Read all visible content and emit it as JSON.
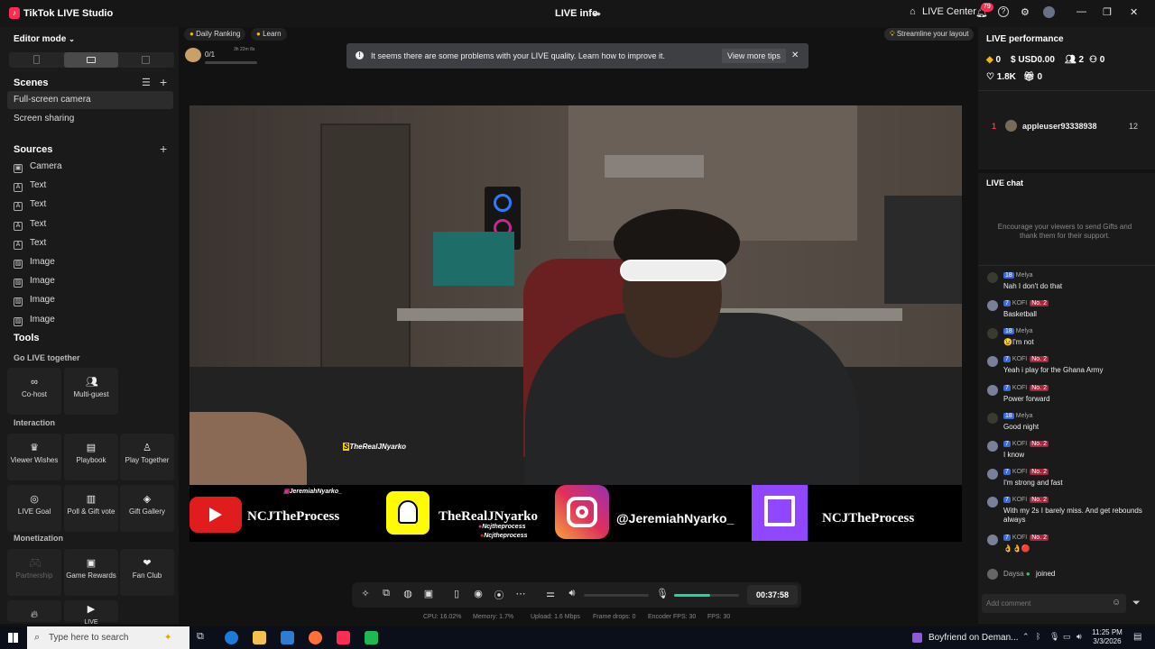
{
  "titlebar": {
    "app_title": "TikTok LIVE Studio",
    "center_title": "LIVE info",
    "live_center": "LIVE Center",
    "notif_count": "79"
  },
  "left": {
    "editor_mode": "Editor mode",
    "scenes_title": "Scenes",
    "scenes": [
      "Full-screen camera",
      "Screen sharing"
    ],
    "sources_title": "Sources",
    "sources": [
      {
        "label": "Camera",
        "icon": "camera-icon"
      },
      {
        "label": "Text",
        "icon": "text-icon"
      },
      {
        "label": "Text",
        "icon": "text-icon"
      },
      {
        "label": "Text",
        "icon": "text-icon"
      },
      {
        "label": "Text",
        "icon": "text-icon"
      },
      {
        "label": "Image",
        "icon": "image-icon"
      },
      {
        "label": "Image",
        "icon": "image-icon"
      },
      {
        "label": "Image",
        "icon": "image-icon"
      },
      {
        "label": "Image",
        "icon": "image-icon"
      }
    ],
    "tools_title": "Tools",
    "go_live_together": "Go LIVE together",
    "cohost": "Co-host",
    "multiguest": "Multi-guest",
    "interaction": "Interaction",
    "viewer_wishes": "Viewer Wishes",
    "playbook": "Playbook",
    "play_together": "Play Together",
    "live_goal": "LIVE Goal",
    "poll_gift_vote": "Poll & Gift vote",
    "gift_gallery": "Gift Gallery",
    "monetization": "Monetization",
    "partnership": "Partnership",
    "game_rewards": "Game Rewards",
    "fan_club": "Fan Club",
    "live_partial": "LIVE"
  },
  "center": {
    "daily_ranking": "Daily Ranking",
    "learn": "Learn",
    "goal_progress": "0/1",
    "goal_time": "3h 22m 8s",
    "goal_fraction": 0.0,
    "streamline": "Streamline your layout",
    "alert_text": "It seems there are some problems with your LIVE quality. Learn how to improve it.",
    "view_tips": "View more tips",
    "overlay_handle": "TheRealJNyarko",
    "banner": {
      "youtube": "NCJTheProcess",
      "snapchat": "TheRealJNyarko",
      "instagram": "@JeremiahNyarko_",
      "twitch": "NCJTheProcess",
      "top_tag": "JeremiahNyarko_",
      "sub_tag1": "Ncjtheprocess",
      "sub_tag2": "Ncjtheprocess"
    },
    "timer": "00:37:58",
    "mic_level": 0.55,
    "stats": {
      "cpu": "CPU: 16.02%",
      "memory": "Memory: 1.7%",
      "upload": "Upload: 1.6 Mbps",
      "frame_drops": "Frame drops: 0",
      "encoder_fps": "Encoder FPS: 30",
      "fps": "FPS: 30"
    }
  },
  "right": {
    "perf_title": "LIVE performance",
    "coins": "0",
    "usd": "USD0.00",
    "viewers": "2",
    "new_followers": "0",
    "likes": "1.8K",
    "gifts": "0",
    "rank_num": "1",
    "rank_user": "appleuser93338938",
    "rank_score": "12",
    "chat_title": "LIVE chat",
    "chat_hint": "Encourage your viewers to send Gifts and thank them for their support.",
    "messages": [
      {
        "user": "Melya",
        "level": "18",
        "rank": "",
        "text": "Nah I don't do that"
      },
      {
        "user": "KOFI",
        "level": "7",
        "rank": "No. 2",
        "text": "Basketball"
      },
      {
        "user": "Melya",
        "level": "18",
        "rank": "",
        "text": "😉I'm not"
      },
      {
        "user": "KOFI",
        "level": "7",
        "rank": "No. 2",
        "text": "Yeah i play for the Ghana Army"
      },
      {
        "user": "KOFI",
        "level": "7",
        "rank": "No. 2",
        "text": "Power forward"
      },
      {
        "user": "Melya",
        "level": "18",
        "rank": "",
        "text": "Good night"
      },
      {
        "user": "KOFI",
        "level": "7",
        "rank": "No. 2",
        "text": "I know"
      },
      {
        "user": "KOFI",
        "level": "7",
        "rank": "No. 2",
        "text": "I'm strong and fast"
      },
      {
        "user": "KOFI",
        "level": "7",
        "rank": "No. 2",
        "text": "With my 2s I barely miss. And get rebounds always"
      },
      {
        "user": "KOFI",
        "level": "7",
        "rank": "No. 2",
        "text": "👌👌🔴"
      }
    ],
    "joined_user": "Daysa",
    "joined_text": "joined",
    "comment_placeholder": "Add comment"
  },
  "taskbar": {
    "search_placeholder": "Type here to search",
    "media_title": "Boyfriend on Deman...",
    "time": "11:25 PM",
    "date": "3/3/2026"
  }
}
